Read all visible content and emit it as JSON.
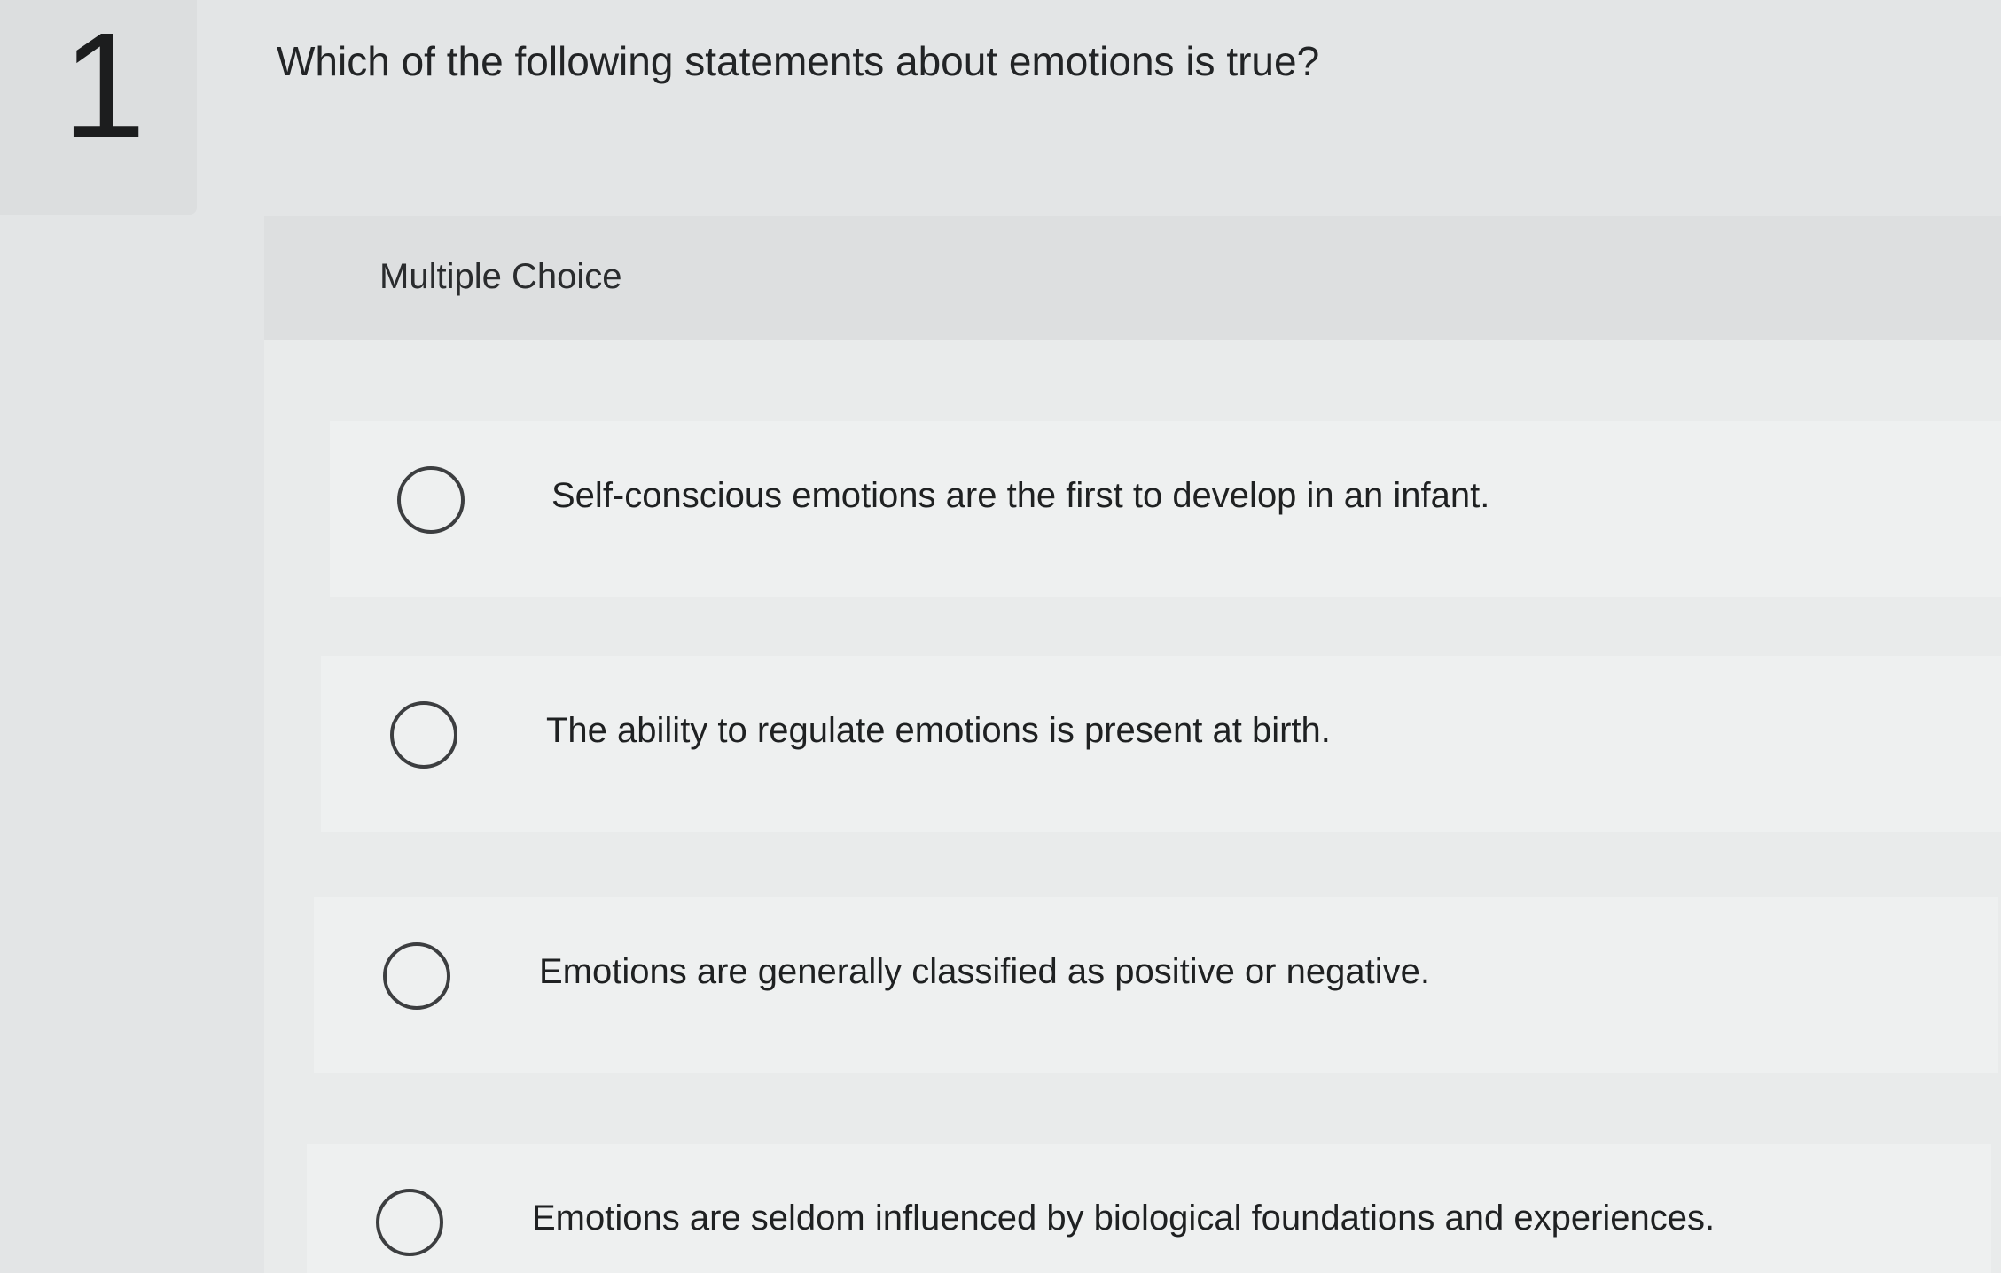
{
  "question": {
    "number": "1",
    "text": "Which of the following statements about emotions is true?"
  },
  "panel": {
    "type_label": "Multiple Choice"
  },
  "options": [
    {
      "text": "Self-conscious emotions are the first to develop in an infant.",
      "selected": false
    },
    {
      "text": "The ability to regulate emotions is present at birth.",
      "selected": false
    },
    {
      "text": "Emotions are generally classified as positive or negative.",
      "selected": false
    },
    {
      "text": "Emotions are seldom influenced by biological foundations and experiences.",
      "selected": false
    }
  ],
  "colors": {
    "background": "#e3e5e6",
    "panel": "#e9ebeb",
    "option_row": "#eef0f0",
    "text": "#1f2122",
    "radio_border": "#3c3e40"
  }
}
